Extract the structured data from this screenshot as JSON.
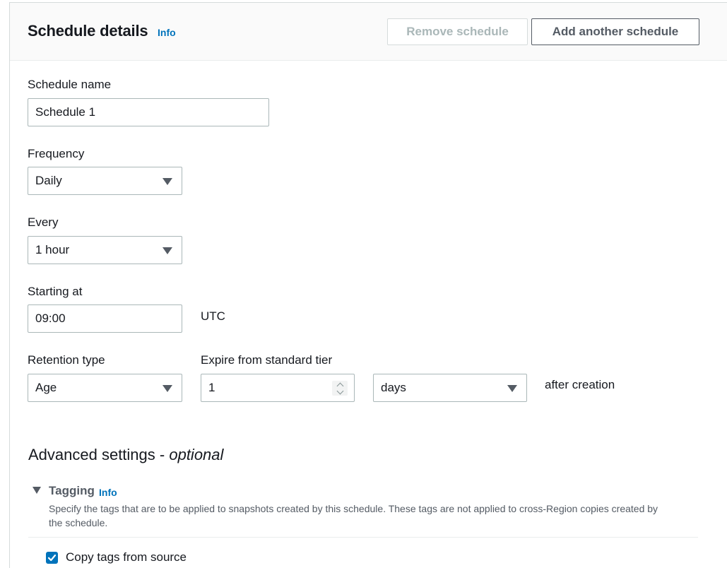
{
  "header": {
    "title": "Schedule details",
    "info_label": "Info",
    "remove_label": "Remove schedule",
    "add_label": "Add another schedule"
  },
  "form": {
    "schedule_name_label": "Schedule name",
    "schedule_name_value": "Schedule 1",
    "frequency_label": "Frequency",
    "frequency_value": "Daily",
    "every_label": "Every",
    "every_value": "1 hour",
    "starting_at_label": "Starting at",
    "starting_at_value": "09:00",
    "timezone": "UTC",
    "retention_type_label": "Retention type",
    "retention_type_value": "Age",
    "expire_label": "Expire from standard tier",
    "expire_value": "1",
    "expire_unit_value": "days",
    "expire_suffix": "after creation"
  },
  "advanced": {
    "title_prefix": "Advanced settings - ",
    "title_optional": "optional",
    "tagging_label": "Tagging",
    "tagging_info": "Info",
    "tagging_description": "Specify the tags that are to be applied to snapshots created by this schedule. These tags are not applied to cross-Region copies created by the schedule.",
    "copy_tags_label": "Copy tags from source",
    "copy_tags_checked": true
  },
  "colors": {
    "accent": "#0073bb",
    "text": "#16191f",
    "muted": "#545b64",
    "disabled": "#aab7b8"
  }
}
